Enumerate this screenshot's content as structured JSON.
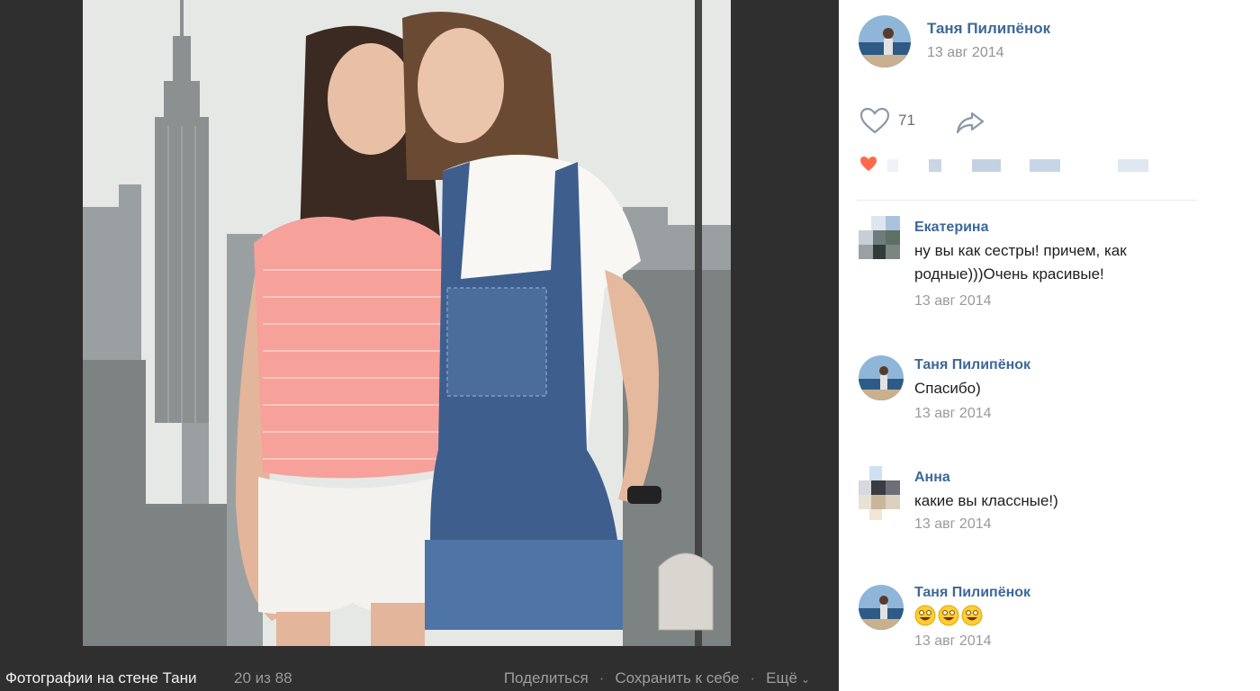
{
  "viewer": {
    "album_title": "Фотографии на стене Тани",
    "counter": "20 из 88",
    "actions": [
      {
        "label": "Поделиться"
      },
      {
        "label": "Сохранить к себе"
      },
      {
        "label": "Ещё"
      }
    ],
    "photo_description_icon": "photo-two-women-skyline"
  },
  "post": {
    "author": "Таня Пилипёнок",
    "date": "13 авг 2014",
    "likes": "71",
    "accent_color": "#3d6899"
  },
  "comments": [
    {
      "author": "Екатерина",
      "text": "ну вы как сестры! причем, как родные)))Очень красивые!",
      "date": "13 авг 2014"
    },
    {
      "author": "Таня Пилипёнок",
      "text": "Спасибо)",
      "date": "13 авг 2014"
    },
    {
      "author": "Анна",
      "text": "какие вы классные!)",
      "date": "13 авг 2014"
    },
    {
      "author": "Таня Пилипёнок",
      "text": "",
      "date": "13 авг 2014",
      "emojis": [
        "grinning-face-icon",
        "grinning-face-icon",
        "grinning-face-icon"
      ]
    }
  ]
}
